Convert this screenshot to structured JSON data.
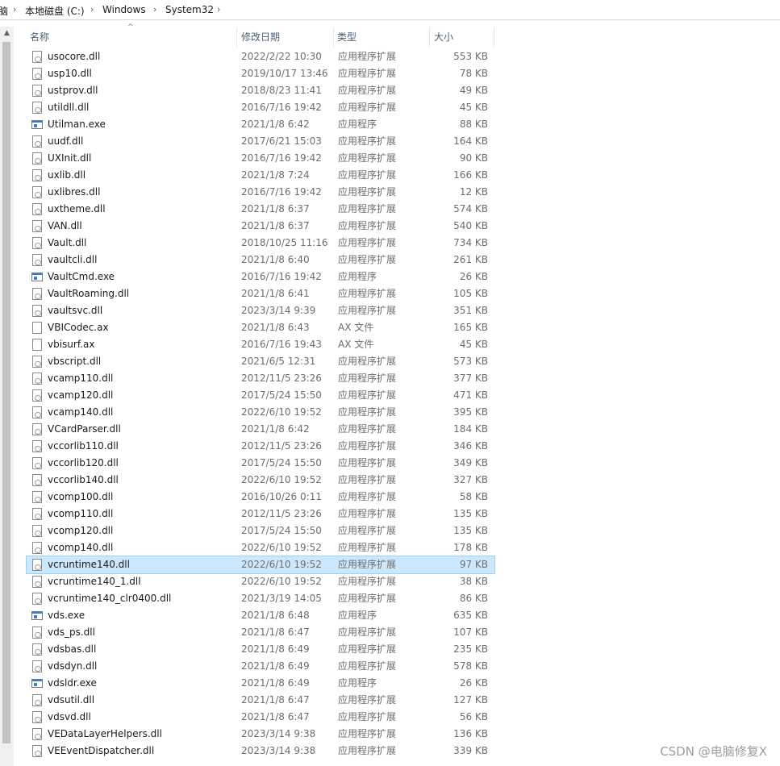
{
  "breadcrumb": {
    "parts": [
      "脑",
      "本地磁盘 (C:)",
      "Windows",
      "System32"
    ]
  },
  "columns": {
    "name": "名称",
    "date": "修改日期",
    "type": "类型",
    "size": "大小"
  },
  "files": [
    {
      "name": "usocore.dll",
      "date": "2022/2/22 10:30",
      "type": "应用程序扩展",
      "size": "553 KB",
      "icon": "dll"
    },
    {
      "name": "usp10.dll",
      "date": "2019/10/17 13:46",
      "type": "应用程序扩展",
      "size": "78 KB",
      "icon": "dll"
    },
    {
      "name": "ustprov.dll",
      "date": "2018/8/23 11:41",
      "type": "应用程序扩展",
      "size": "49 KB",
      "icon": "dll"
    },
    {
      "name": "utildll.dll",
      "date": "2016/7/16 19:42",
      "type": "应用程序扩展",
      "size": "45 KB",
      "icon": "dll"
    },
    {
      "name": "Utilman.exe",
      "date": "2021/1/8 6:42",
      "type": "应用程序",
      "size": "88 KB",
      "icon": "exe"
    },
    {
      "name": "uudf.dll",
      "date": "2017/6/21 15:03",
      "type": "应用程序扩展",
      "size": "164 KB",
      "icon": "dll"
    },
    {
      "name": "UXInit.dll",
      "date": "2016/7/16 19:42",
      "type": "应用程序扩展",
      "size": "90 KB",
      "icon": "dll"
    },
    {
      "name": "uxlib.dll",
      "date": "2021/1/8 7:24",
      "type": "应用程序扩展",
      "size": "166 KB",
      "icon": "dll"
    },
    {
      "name": "uxlibres.dll",
      "date": "2016/7/16 19:42",
      "type": "应用程序扩展",
      "size": "12 KB",
      "icon": "dll"
    },
    {
      "name": "uxtheme.dll",
      "date": "2021/1/8 6:37",
      "type": "应用程序扩展",
      "size": "574 KB",
      "icon": "dll"
    },
    {
      "name": "VAN.dll",
      "date": "2021/1/8 6:37",
      "type": "应用程序扩展",
      "size": "540 KB",
      "icon": "dll"
    },
    {
      "name": "Vault.dll",
      "date": "2018/10/25 11:16",
      "type": "应用程序扩展",
      "size": "734 KB",
      "icon": "dll"
    },
    {
      "name": "vaultcli.dll",
      "date": "2021/1/8 6:40",
      "type": "应用程序扩展",
      "size": "261 KB",
      "icon": "dll"
    },
    {
      "name": "VaultCmd.exe",
      "date": "2016/7/16 19:42",
      "type": "应用程序",
      "size": "26 KB",
      "icon": "exe"
    },
    {
      "name": "VaultRoaming.dll",
      "date": "2021/1/8 6:41",
      "type": "应用程序扩展",
      "size": "105 KB",
      "icon": "dll"
    },
    {
      "name": "vaultsvc.dll",
      "date": "2023/3/14 9:39",
      "type": "应用程序扩展",
      "size": "351 KB",
      "icon": "dll"
    },
    {
      "name": "VBICodec.ax",
      "date": "2021/1/8 6:43",
      "type": "AX 文件",
      "size": "165 KB",
      "icon": "ax"
    },
    {
      "name": "vbisurf.ax",
      "date": "2016/7/16 19:43",
      "type": "AX 文件",
      "size": "45 KB",
      "icon": "ax"
    },
    {
      "name": "vbscript.dll",
      "date": "2021/6/5 12:31",
      "type": "应用程序扩展",
      "size": "573 KB",
      "icon": "dll"
    },
    {
      "name": "vcamp110.dll",
      "date": "2012/11/5 23:26",
      "type": "应用程序扩展",
      "size": "377 KB",
      "icon": "dll"
    },
    {
      "name": "vcamp120.dll",
      "date": "2017/5/24 15:50",
      "type": "应用程序扩展",
      "size": "471 KB",
      "icon": "dll"
    },
    {
      "name": "vcamp140.dll",
      "date": "2022/6/10 19:52",
      "type": "应用程序扩展",
      "size": "395 KB",
      "icon": "dll"
    },
    {
      "name": "VCardParser.dll",
      "date": "2021/1/8 6:42",
      "type": "应用程序扩展",
      "size": "184 KB",
      "icon": "dll"
    },
    {
      "name": "vccorlib110.dll",
      "date": "2012/11/5 23:26",
      "type": "应用程序扩展",
      "size": "346 KB",
      "icon": "dll"
    },
    {
      "name": "vccorlib120.dll",
      "date": "2017/5/24 15:50",
      "type": "应用程序扩展",
      "size": "349 KB",
      "icon": "dll"
    },
    {
      "name": "vccorlib140.dll",
      "date": "2022/6/10 19:52",
      "type": "应用程序扩展",
      "size": "327 KB",
      "icon": "dll"
    },
    {
      "name": "vcomp100.dll",
      "date": "2016/10/26 0:11",
      "type": "应用程序扩展",
      "size": "58 KB",
      "icon": "dll"
    },
    {
      "name": "vcomp110.dll",
      "date": "2012/11/5 23:26",
      "type": "应用程序扩展",
      "size": "135 KB",
      "icon": "dll"
    },
    {
      "name": "vcomp120.dll",
      "date": "2017/5/24 15:50",
      "type": "应用程序扩展",
      "size": "135 KB",
      "icon": "dll"
    },
    {
      "name": "vcomp140.dll",
      "date": "2022/6/10 19:52",
      "type": "应用程序扩展",
      "size": "178 KB",
      "icon": "dll"
    },
    {
      "name": "vcruntime140.dll",
      "date": "2022/6/10 19:52",
      "type": "应用程序扩展",
      "size": "97 KB",
      "icon": "dll",
      "selected": true
    },
    {
      "name": "vcruntime140_1.dll",
      "date": "2022/6/10 19:52",
      "type": "应用程序扩展",
      "size": "38 KB",
      "icon": "dll"
    },
    {
      "name": "vcruntime140_clr0400.dll",
      "date": "2021/3/19 14:05",
      "type": "应用程序扩展",
      "size": "86 KB",
      "icon": "dll"
    },
    {
      "name": "vds.exe",
      "date": "2021/1/8 6:48",
      "type": "应用程序",
      "size": "635 KB",
      "icon": "exe"
    },
    {
      "name": "vds_ps.dll",
      "date": "2021/1/8 6:47",
      "type": "应用程序扩展",
      "size": "107 KB",
      "icon": "dll"
    },
    {
      "name": "vdsbas.dll",
      "date": "2021/1/8 6:49",
      "type": "应用程序扩展",
      "size": "235 KB",
      "icon": "dll"
    },
    {
      "name": "vdsdyn.dll",
      "date": "2021/1/8 6:49",
      "type": "应用程序扩展",
      "size": "578 KB",
      "icon": "dll"
    },
    {
      "name": "vdsldr.exe",
      "date": "2021/1/8 6:49",
      "type": "应用程序",
      "size": "26 KB",
      "icon": "exe"
    },
    {
      "name": "vdsutil.dll",
      "date": "2021/1/8 6:47",
      "type": "应用程序扩展",
      "size": "127 KB",
      "icon": "dll"
    },
    {
      "name": "vdsvd.dll",
      "date": "2021/1/8 6:47",
      "type": "应用程序扩展",
      "size": "56 KB",
      "icon": "dll"
    },
    {
      "name": "VEDataLayerHelpers.dll",
      "date": "2023/3/14 9:38",
      "type": "应用程序扩展",
      "size": "136 KB",
      "icon": "dll"
    },
    {
      "name": "VEEventDispatcher.dll",
      "date": "2023/3/14 9:38",
      "type": "应用程序扩展",
      "size": "339 KB",
      "icon": "dll"
    }
  ],
  "watermark": "CSDN @电脑修复X"
}
